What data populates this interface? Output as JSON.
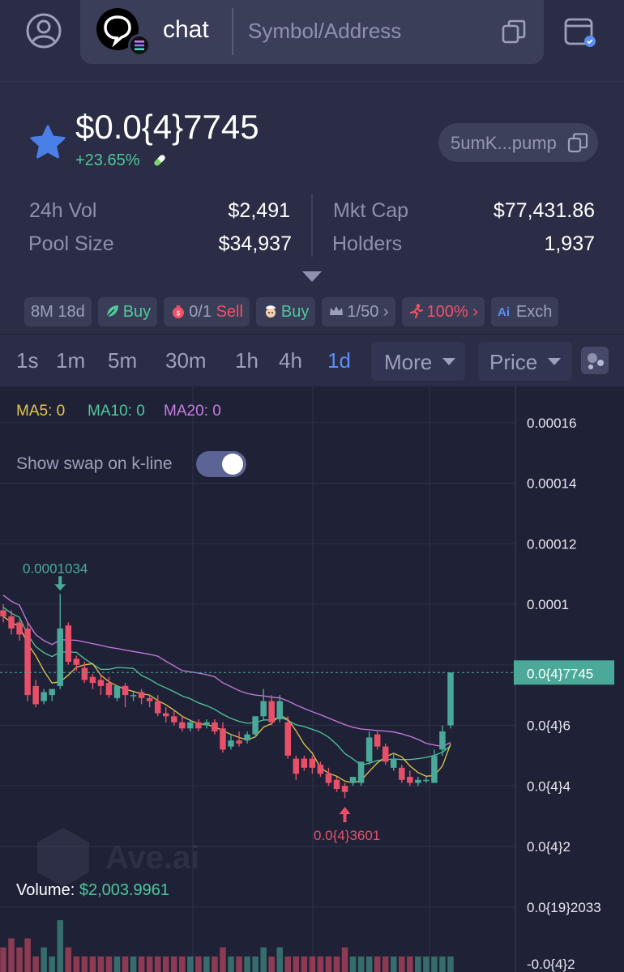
{
  "header": {
    "chat_label": "chat",
    "search_placeholder": "Symbol/Address"
  },
  "token": {
    "price": "$0.0{4}7745",
    "change": "+23.65%",
    "address_short": "5umK...pump",
    "stats": {
      "vol_label": "24h Vol",
      "vol_value": "$2,491",
      "pool_label": "Pool Size",
      "pool_value": "$34,937",
      "mcap_label": "Mkt Cap",
      "mcap_value": "$77,431.86",
      "holders_label": "Holders",
      "holders_value": "1,937"
    },
    "tags": {
      "age": "8M 18d",
      "buy": "Buy",
      "buy_sell_count": "0/1",
      "sell": "Sell",
      "dev_buy": "Buy",
      "top_ratio": "1/50",
      "run_pct": "100%",
      "exch": "Exch"
    }
  },
  "tabs": {
    "items": [
      "1s",
      "1m",
      "5m",
      "30m",
      "1h",
      "4h",
      "1d"
    ],
    "active": "1d",
    "more": "More",
    "price": "Price"
  },
  "chart": {
    "ma5": "MA5: 0",
    "ma10": "MA10: 0",
    "ma20": "MA20: 0",
    "swap_label": "Show swap on k-line",
    "swap_on": true,
    "volume_label": "Volume:",
    "volume_value": "$2,003.9961",
    "watermark": "Ave.ai",
    "y_ticks": [
      "0.00016",
      "0.00014",
      "0.00012",
      "0.0001",
      "0.0{4}6",
      "0.0{4}4",
      "0.0{4}2",
      "0.0{19}2033",
      "-0.0{4}2"
    ],
    "current_price_label": "0.0{4}7745",
    "high_label": "0.0001034",
    "low_label": "0.0{4}3601"
  },
  "chart_data": {
    "type": "candlestick",
    "y_unit": "price (USD)",
    "ylim": [
      -2e-05,
      0.00017
    ],
    "grid": true,
    "ma_legend": [
      "MA5: 0",
      "MA10: 0",
      "MA20: 0"
    ],
    "high_marker": 0.0001034,
    "low_marker": 3.601e-05,
    "last_price": 7.745e-05,
    "candles": [
      {
        "o": 9.8e-05,
        "h": 0.0001,
        "c": 9.6e-05,
        "l": 9.4e-05
      },
      {
        "o": 9.6e-05,
        "h": 9.8e-05,
        "c": 9.2e-05,
        "l": 9e-05
      },
      {
        "o": 9.4e-05,
        "h": 9.5e-05,
        "c": 9e-05,
        "l": 8.8e-05
      },
      {
        "o": 9.2e-05,
        "h": 9.4e-05,
        "c": 7e-05,
        "l": 6.8e-05
      },
      {
        "o": 7.3e-05,
        "h": 7.5e-05,
        "c": 6.7e-05,
        "l": 6.6e-05
      },
      {
        "o": 6.8e-05,
        "h": 7.2e-05,
        "c": 7.1e-05,
        "l": 6.7e-05
      },
      {
        "o": 7e-05,
        "h": 7.1e-05,
        "c": 7.2e-05,
        "l": 6.8e-05
      },
      {
        "o": 7.3e-05,
        "h": 0.0001034,
        "c": 9.2e-05,
        "l": 7.2e-05
      },
      {
        "o": 9.3e-05,
        "h": 9.4e-05,
        "c": 8.1e-05,
        "l": 8e-05
      },
      {
        "o": 8.2e-05,
        "h": 8.3e-05,
        "c": 8e-05,
        "l": 7.8e-05
      },
      {
        "o": 7.9e-05,
        "h": 8.1e-05,
        "c": 7.5e-05,
        "l": 7.4e-05
      },
      {
        "o": 7.6e-05,
        "h": 7.7e-05,
        "c": 7.4e-05,
        "l": 7.2e-05
      },
      {
        "o": 7.5e-05,
        "h": 7.7e-05,
        "c": 7.3e-05,
        "l": 7e-05
      },
      {
        "o": 7.4e-05,
        "h": 7.6e-05,
        "c": 7e-05,
        "l": 6.9e-05
      },
      {
        "o": 6.9e-05,
        "h": 7.1e-05,
        "c": 7.3e-05,
        "l": 6.8e-05
      },
      {
        "o": 7.3e-05,
        "h": 7.4e-05,
        "c": 7e-05,
        "l": 6.6e-05
      },
      {
        "o": 7e-05,
        "h": 7.1e-05,
        "c": 7e-05,
        "l": 6.8e-05
      },
      {
        "o": 7.1e-05,
        "h": 7.2e-05,
        "c": 6.9e-05,
        "l": 6.7e-05
      },
      {
        "o": 6.9e-05,
        "h": 7e-05,
        "c": 6.8e-05,
        "l": 6.6e-05
      },
      {
        "o": 6.8e-05,
        "h": 7e-05,
        "c": 6.4e-05,
        "l": 6.3e-05
      },
      {
        "o": 6.4e-05,
        "h": 6.6e-05,
        "c": 6.3e-05,
        "l": 6.1e-05
      },
      {
        "o": 6.3e-05,
        "h": 6.5e-05,
        "c": 6.1e-05,
        "l": 6e-05
      },
      {
        "o": 6.1e-05,
        "h": 6.3e-05,
        "c": 5.9e-05,
        "l": 5.8e-05
      },
      {
        "o": 5.9e-05,
        "h": 6.2e-05,
        "c": 6.1e-05,
        "l": 5.8e-05
      },
      {
        "o": 6.1e-05,
        "h": 6.2e-05,
        "c": 5.9e-05,
        "l": 5.8e-05
      },
      {
        "o": 6e-05,
        "h": 6.2e-05,
        "c": 6.1e-05,
        "l": 5.9e-05
      },
      {
        "o": 6.1e-05,
        "h": 6.2e-05,
        "c": 5.8e-05,
        "l": 5.7e-05
      },
      {
        "o": 5.9e-05,
        "h": 6.1e-05,
        "c": 5.2e-05,
        "l": 5.1e-05
      },
      {
        "o": 5.3e-05,
        "h": 5.7e-05,
        "c": 5.5e-05,
        "l": 5.2e-05
      },
      {
        "o": 5.5e-05,
        "h": 5.8e-05,
        "c": 5.4e-05,
        "l": 5.3e-05
      },
      {
        "o": 5.5e-05,
        "h": 5.8e-05,
        "c": 5.7e-05,
        "l": 5.4e-05
      },
      {
        "o": 5.7e-05,
        "h": 5.8e-05,
        "c": 6.3e-05,
        "l": 5.6e-05
      },
      {
        "o": 6.3e-05,
        "h": 7.2e-05,
        "c": 6.8e-05,
        "l": 6.2e-05
      },
      {
        "o": 6.8e-05,
        "h": 7e-05,
        "c": 6.1e-05,
        "l": 6e-05
      },
      {
        "o": 6.2e-05,
        "h": 7e-05,
        "c": 6.8e-05,
        "l": 6.1e-05
      },
      {
        "o": 6.1e-05,
        "h": 6.3e-05,
        "c": 5e-05,
        "l": 4.9e-05
      },
      {
        "o": 4.9e-05,
        "h": 5e-05,
        "c": 4.4e-05,
        "l": 4.2e-05
      },
      {
        "o": 4.9e-05,
        "h": 5e-05,
        "c": 4.6e-05,
        "l": 4.5e-05
      },
      {
        "o": 4.9e-05,
        "h": 5e-05,
        "c": 4.6e-05,
        "l": 4.4e-05
      },
      {
        "o": 4.7e-05,
        "h": 4.8e-05,
        "c": 4.4e-05,
        "l": 4.3e-05
      },
      {
        "o": 4.4e-05,
        "h": 4.6e-05,
        "c": 4.1e-05,
        "l": 4e-05
      },
      {
        "o": 4.2e-05,
        "h": 4.3e-05,
        "c": 3.9e-05,
        "l": 3.8e-05
      },
      {
        "o": 4e-05,
        "h": 4.1e-05,
        "c": 3.8e-05,
        "l": 3.601e-05
      },
      {
        "o": 4.1e-05,
        "h": 4.2e-05,
        "c": 4.3e-05,
        "l": 4e-05
      },
      {
        "o": 4.1e-05,
        "h": 4.4e-05,
        "c": 4.8e-05,
        "l": 4e-05
      },
      {
        "o": 4.8e-05,
        "h": 5.8e-05,
        "c": 5.6e-05,
        "l": 4.7e-05
      },
      {
        "o": 5.7e-05,
        "h": 5.8e-05,
        "c": 5.3e-05,
        "l": 5.2e-05
      },
      {
        "o": 5.3e-05,
        "h": 5.4e-05,
        "c": 4.8e-05,
        "l": 4.7e-05
      },
      {
        "o": 4.6e-05,
        "h": 5.1e-05,
        "c": 4.9e-05,
        "l": 4.5e-05
      },
      {
        "o": 4.6e-05,
        "h": 4.7e-05,
        "c": 4.2e-05,
        "l": 4.1e-05
      },
      {
        "o": 4.3e-05,
        "h": 4.5e-05,
        "c": 4.1e-05,
        "l": 4e-05
      },
      {
        "o": 4.1e-05,
        "h": 4.3e-05,
        "c": 4.2e-05,
        "l": 4e-05
      },
      {
        "o": 4.2e-05,
        "h": 4.3e-05,
        "c": 4.2e-05,
        "l": 4.1e-05
      },
      {
        "o": 4.1e-05,
        "h": 5.2e-05,
        "c": 5e-05,
        "l": 4.1e-05
      },
      {
        "o": 5.2e-05,
        "h": 6e-05,
        "c": 5.8e-05,
        "l": 5e-05
      },
      {
        "o": 6e-05,
        "h": 7.745e-05,
        "c": 7.745e-05,
        "l": 5.9e-05
      }
    ],
    "volumes": [
      2,
      3,
      2,
      3,
      1,
      2,
      1,
      5,
      2,
      1,
      1,
      1,
      1,
      1,
      1,
      1,
      1,
      1,
      1,
      1,
      1,
      1,
      1,
      1,
      1,
      1,
      1,
      2,
      1,
      1,
      1,
      1,
      2,
      1,
      2,
      1,
      1,
      1,
      1,
      1,
      1,
      1,
      2,
      1,
      1,
      1,
      1,
      1,
      1,
      1,
      1,
      1,
      1,
      1,
      1,
      1
    ]
  },
  "colors": {
    "up": "#4aa999",
    "down": "#e8506a",
    "ma5": "#e5c64a",
    "ma10": "#4fc79b",
    "ma20": "#c97be0",
    "accent": "#5b8ef4"
  }
}
